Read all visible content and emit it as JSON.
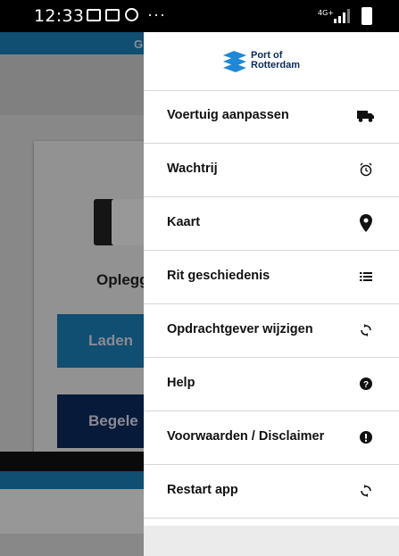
{
  "status_bar": {
    "time": "12:33",
    "dots": "···",
    "network": "4G+"
  },
  "background_app": {
    "header_letter": "G",
    "label": "Oplegg",
    "button_laden": "Laden",
    "button_begeleid": "Begele"
  },
  "drawer": {
    "logo_line1": "Port of",
    "logo_line2": "Rotterdam",
    "items": [
      {
        "label": "Voertuig aanpassen",
        "icon": "truck-icon"
      },
      {
        "label": "Wachtrij",
        "icon": "alarm-clock-icon"
      },
      {
        "label": "Kaart",
        "icon": "map-pin-icon"
      },
      {
        "label": "Rit geschiedenis",
        "icon": "list-icon"
      },
      {
        "label": "Opdrachtgever wijzigen",
        "icon": "sync-icon"
      },
      {
        "label": "Help",
        "icon": "question-circle-icon"
      },
      {
        "label": "Voorwaarden / Disclaimer",
        "icon": "exclamation-circle-icon"
      },
      {
        "label": "Restart app",
        "icon": "sync-icon"
      }
    ]
  },
  "colors": {
    "brand_blue": "#1b7fb8",
    "brand_navy": "#0d2a5c",
    "logo_blue": "#1e88d8"
  }
}
